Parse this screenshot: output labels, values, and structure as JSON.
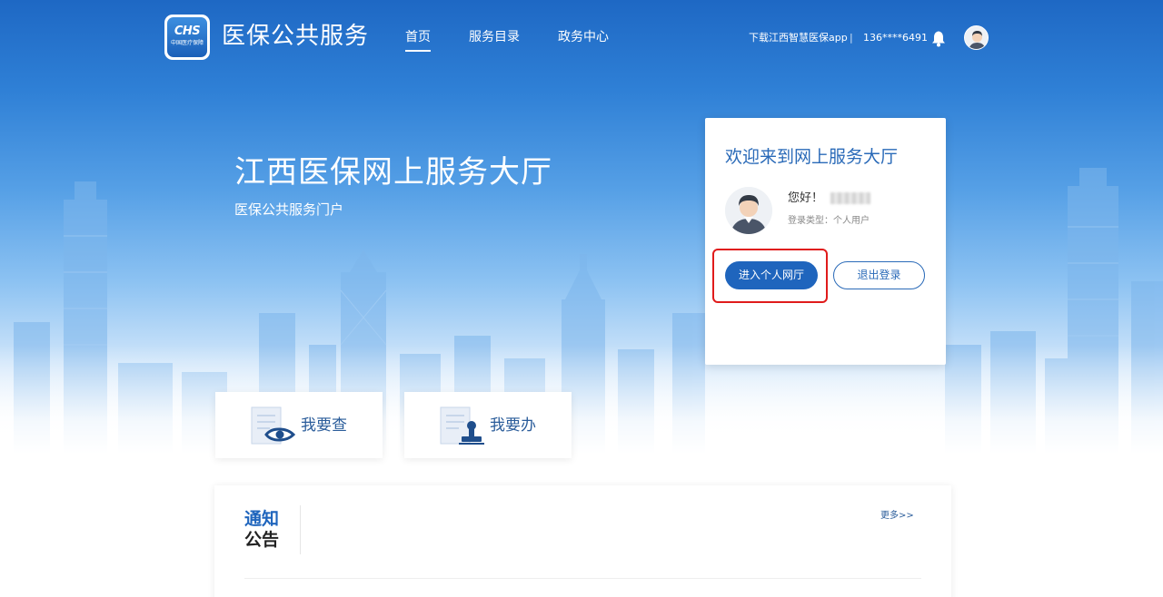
{
  "header": {
    "logo_text": "CHS",
    "logo_sub": "中国医疗保障",
    "site_title": "医保公共服务",
    "nav": [
      {
        "label": "首页",
        "active": true
      },
      {
        "label": "服务目录",
        "active": false
      },
      {
        "label": "政务中心",
        "active": false
      }
    ],
    "download_app": "下载江西智慧医保app",
    "separator": "|",
    "phone": "136****6491"
  },
  "hero": {
    "title": "江西医保网上服务大厅",
    "subtitle": "医保公共服务门户"
  },
  "welcome_card": {
    "title": "欢迎来到网上服务大厅",
    "greeting": "您好！",
    "login_type": "登录类型：个人用户",
    "enter_button": "进入个人网厅",
    "logout_button": "退出登录"
  },
  "tiles": [
    {
      "label": "我要查",
      "icon": "search-document-eye-icon"
    },
    {
      "label": "我要办",
      "icon": "document-stamp-icon"
    }
  ],
  "notice": {
    "title_line1": "通知",
    "title_line2": "公告",
    "more": "更多>>"
  },
  "colors": {
    "brand_blue": "#1f65bd",
    "highlight_red": "#e01b1b"
  }
}
